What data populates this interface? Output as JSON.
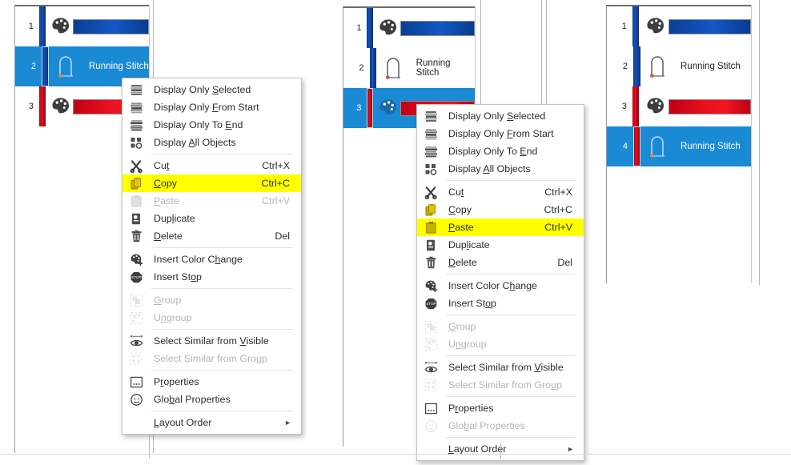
{
  "app": {
    "title": "Embroidery Object List — context menu comparison",
    "accent_selection": "#1b8ad5",
    "highlight": "#ffff00",
    "color_blue": "#1450b8",
    "color_red": "#e0101f"
  },
  "panels": [
    {
      "name": "left-panel",
      "rows": [
        {
          "index": "1",
          "type": "color-change",
          "bar": "blue",
          "swatch": "blue",
          "label": "",
          "selected": false
        },
        {
          "index": "2",
          "type": "stitch",
          "bar": "blue",
          "swatch": "",
          "label": "Running Stitch",
          "selected": true
        },
        {
          "index": "3",
          "type": "color-change",
          "bar": "red",
          "swatch": "red",
          "label": "",
          "selected": false
        }
      ]
    },
    {
      "name": "middle-panel",
      "rows": [
        {
          "index": "1",
          "type": "color-change",
          "bar": "blue",
          "swatch": "blue",
          "label": "",
          "selected": false
        },
        {
          "index": "2",
          "type": "stitch",
          "bar": "blue",
          "swatch": "",
          "label": "Running Stitch",
          "selected": false
        },
        {
          "index": "3",
          "type": "color-change",
          "bar": "red",
          "swatch": "red",
          "label": "",
          "selected": true
        }
      ]
    },
    {
      "name": "right-panel",
      "rows": [
        {
          "index": "1",
          "type": "color-change",
          "bar": "blue",
          "swatch": "blue",
          "label": "",
          "selected": false
        },
        {
          "index": "2",
          "type": "stitch",
          "bar": "blue",
          "swatch": "",
          "label": "Running Stitch",
          "selected": false
        },
        {
          "index": "3",
          "type": "color-change",
          "bar": "red",
          "swatch": "red",
          "label": "",
          "selected": false
        },
        {
          "index": "4",
          "type": "stitch",
          "bar": "red",
          "swatch": "",
          "label": "Running Stitch",
          "selected": true
        }
      ]
    }
  ],
  "menu_copy": {
    "name": "context-menu-copy",
    "items": [
      {
        "icon": "display-selected-icon",
        "label": "Display Only ",
        "label_acc": "S",
        "label_tail": "elected",
        "accel": "",
        "disabled": false,
        "highlighted": false,
        "submenu": false
      },
      {
        "icon": "display-from-start-icon",
        "label": "Display Only ",
        "label_acc": "F",
        "label_tail": "rom Start",
        "accel": "",
        "disabled": false,
        "highlighted": false,
        "submenu": false
      },
      {
        "icon": "display-to-end-icon",
        "label": "Display Only To ",
        "label_acc": "E",
        "label_tail": "nd",
        "accel": "",
        "disabled": false,
        "highlighted": false,
        "submenu": false
      },
      {
        "icon": "display-all-objects-icon",
        "label": "Display ",
        "label_acc": "A",
        "label_tail": "ll Objects",
        "accel": "",
        "disabled": false,
        "highlighted": false,
        "submenu": false
      },
      {
        "separator": true
      },
      {
        "icon": "scissors-icon",
        "label": "Cu",
        "label_acc": "t",
        "label_tail": "",
        "accel": "Ctrl+X",
        "disabled": false,
        "highlighted": false,
        "submenu": false
      },
      {
        "icon": "copy-icon",
        "label": "",
        "label_acc": "C",
        "label_tail": "opy",
        "accel": "Ctrl+C",
        "disabled": false,
        "highlighted": true,
        "submenu": false
      },
      {
        "icon": "paste-icon",
        "label": "",
        "label_acc": "P",
        "label_tail": "aste",
        "accel": "Ctrl+V",
        "disabled": true,
        "highlighted": false,
        "submenu": false
      },
      {
        "icon": "duplicate-icon",
        "label": "Dup",
        "label_acc": "l",
        "label_tail": "icate",
        "accel": "",
        "disabled": false,
        "highlighted": false,
        "submenu": false
      },
      {
        "icon": "trash-icon",
        "label": "",
        "label_acc": "D",
        "label_tail": "elete",
        "accel": "Del",
        "disabled": false,
        "highlighted": false,
        "submenu": false
      },
      {
        "separator": true
      },
      {
        "icon": "insert-color-change-icon",
        "label": "Insert Color C",
        "label_acc": "h",
        "label_tail": "ange",
        "accel": "",
        "disabled": false,
        "highlighted": false,
        "submenu": false
      },
      {
        "icon": "insert-stop-icon",
        "label": "Insert St",
        "label_acc": "o",
        "label_tail": "p",
        "accel": "",
        "disabled": false,
        "highlighted": false,
        "submenu": false
      },
      {
        "separator": true
      },
      {
        "icon": "group-icon",
        "label": "",
        "label_acc": "G",
        "label_tail": "roup",
        "accel": "",
        "disabled": true,
        "highlighted": false,
        "submenu": false
      },
      {
        "icon": "ungroup-icon",
        "label": "U",
        "label_acc": "n",
        "label_tail": "group",
        "accel": "",
        "disabled": true,
        "highlighted": false,
        "submenu": false
      },
      {
        "separator": true
      },
      {
        "icon": "select-similar-visible-icon",
        "label": "Select Similar from ",
        "label_acc": "V",
        "label_tail": "isible",
        "accel": "",
        "disabled": false,
        "highlighted": false,
        "submenu": false
      },
      {
        "icon": "select-similar-group-icon",
        "label": "Select Similar from Gro",
        "label_acc": "u",
        "label_tail": "p",
        "accel": "",
        "disabled": true,
        "highlighted": false,
        "submenu": false
      },
      {
        "separator": true
      },
      {
        "icon": "properties-icon",
        "label": "P",
        "label_acc": "r",
        "label_tail": "operties",
        "accel": "",
        "disabled": false,
        "highlighted": false,
        "submenu": false
      },
      {
        "icon": "global-properties-icon",
        "label": "Glo",
        "label_acc": "b",
        "label_tail": "al Properties",
        "accel": "",
        "disabled": false,
        "highlighted": false,
        "submenu": false
      },
      {
        "separator": true
      },
      {
        "icon": "",
        "label": "",
        "label_acc": "L",
        "label_tail": "ayout Order",
        "accel": "",
        "disabled": false,
        "highlighted": false,
        "submenu": true
      }
    ]
  },
  "menu_paste": {
    "name": "context-menu-paste",
    "items": [
      {
        "icon": "display-selected-icon",
        "label": "Display Only ",
        "label_acc": "S",
        "label_tail": "elected",
        "accel": "",
        "disabled": false,
        "highlighted": false,
        "submenu": false
      },
      {
        "icon": "display-from-start-icon",
        "label": "Display Only ",
        "label_acc": "F",
        "label_tail": "rom Start",
        "accel": "",
        "disabled": false,
        "highlighted": false,
        "submenu": false
      },
      {
        "icon": "display-to-end-icon",
        "label": "Display Only To ",
        "label_acc": "E",
        "label_tail": "nd",
        "accel": "",
        "disabled": false,
        "highlighted": false,
        "submenu": false
      },
      {
        "icon": "display-all-objects-icon",
        "label": "Display ",
        "label_acc": "A",
        "label_tail": "ll Objects",
        "accel": "",
        "disabled": false,
        "highlighted": false,
        "submenu": false
      },
      {
        "separator": true
      },
      {
        "icon": "scissors-icon",
        "label": "Cu",
        "label_acc": "t",
        "label_tail": "",
        "accel": "Ctrl+X",
        "disabled": false,
        "highlighted": false,
        "submenu": false
      },
      {
        "icon": "copy-icon",
        "label": "",
        "label_acc": "C",
        "label_tail": "opy",
        "accel": "Ctrl+C",
        "disabled": false,
        "highlighted": false,
        "submenu": false
      },
      {
        "icon": "paste-icon",
        "label": "",
        "label_acc": "P",
        "label_tail": "aste",
        "accel": "Ctrl+V",
        "disabled": false,
        "highlighted": true,
        "submenu": false
      },
      {
        "icon": "duplicate-icon",
        "label": "Dup",
        "label_acc": "l",
        "label_tail": "icate",
        "accel": "",
        "disabled": false,
        "highlighted": false,
        "submenu": false
      },
      {
        "icon": "trash-icon",
        "label": "",
        "label_acc": "D",
        "label_tail": "elete",
        "accel": "Del",
        "disabled": false,
        "highlighted": false,
        "submenu": false
      },
      {
        "separator": true
      },
      {
        "icon": "insert-color-change-icon",
        "label": "Insert Color C",
        "label_acc": "h",
        "label_tail": "ange",
        "accel": "",
        "disabled": false,
        "highlighted": false,
        "submenu": false
      },
      {
        "icon": "insert-stop-icon",
        "label": "Insert St",
        "label_acc": "o",
        "label_tail": "p",
        "accel": "",
        "disabled": false,
        "highlighted": false,
        "submenu": false
      },
      {
        "separator": true
      },
      {
        "icon": "group-icon",
        "label": "",
        "label_acc": "G",
        "label_tail": "roup",
        "accel": "",
        "disabled": true,
        "highlighted": false,
        "submenu": false
      },
      {
        "icon": "ungroup-icon",
        "label": "U",
        "label_acc": "n",
        "label_tail": "group",
        "accel": "",
        "disabled": true,
        "highlighted": false,
        "submenu": false
      },
      {
        "separator": true
      },
      {
        "icon": "select-similar-visible-icon",
        "label": "Select Similar from ",
        "label_acc": "V",
        "label_tail": "isible",
        "accel": "",
        "disabled": false,
        "highlighted": false,
        "submenu": false
      },
      {
        "icon": "select-similar-group-icon",
        "label": "Select Similar from Gro",
        "label_acc": "u",
        "label_tail": "p",
        "accel": "",
        "disabled": true,
        "highlighted": false,
        "submenu": false
      },
      {
        "separator": true
      },
      {
        "icon": "properties-icon",
        "label": "P",
        "label_acc": "r",
        "label_tail": "operties",
        "accel": "",
        "disabled": false,
        "highlighted": false,
        "submenu": false
      },
      {
        "icon": "global-properties-icon",
        "label": "Glo",
        "label_acc": "b",
        "label_tail": "al Properties",
        "accel": "",
        "disabled": true,
        "highlighted": false,
        "submenu": false
      },
      {
        "separator": true
      },
      {
        "icon": "",
        "label": "",
        "label_acc": "L",
        "label_tail": "ayout Order",
        "accel": "",
        "disabled": false,
        "highlighted": false,
        "submenu": true
      }
    ]
  }
}
